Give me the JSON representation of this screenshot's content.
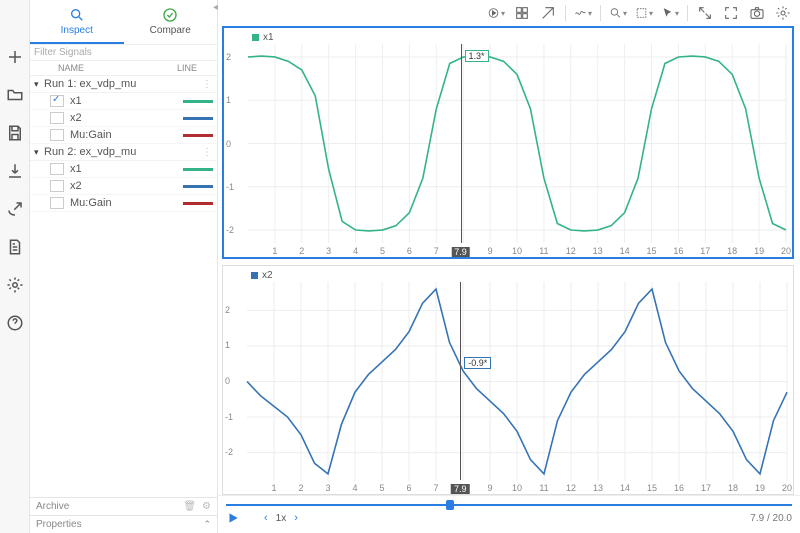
{
  "tabs": {
    "inspect": "Inspect",
    "compare": "Compare"
  },
  "filter_placeholder": "Filter Signals",
  "columns": {
    "name": "NAME",
    "line": "LINE"
  },
  "colors": {
    "green": "#34b38a",
    "blue": "#3573b3",
    "red": "#b22e2e",
    "accent": "#2a7de1"
  },
  "runs": [
    {
      "label": "Run 1: ex_vdp_mu",
      "signals": [
        {
          "label": "x1",
          "color_key": "green",
          "checked": true
        },
        {
          "label": "x2",
          "color_key": "blue",
          "checked": false
        },
        {
          "label": "Mu:Gain",
          "color_key": "red",
          "checked": false
        }
      ]
    },
    {
      "label": "Run 2: ex_vdp_mu",
      "signals": [
        {
          "label": "x1",
          "color_key": "green",
          "checked": false
        },
        {
          "label": "x2",
          "color_key": "blue",
          "checked": false
        },
        {
          "label": "Mu:Gain",
          "color_key": "red",
          "checked": false
        }
      ]
    }
  ],
  "panels": {
    "archive": "Archive",
    "properties": "Properties"
  },
  "cursor_time": 7.9,
  "playback": {
    "speed_label": "1x",
    "time_label": "7.9 / 20.0",
    "progress_frac": 0.395
  },
  "chart_data": [
    {
      "type": "line",
      "legend": "x1",
      "color_key": "green",
      "xlim": [
        0,
        20
      ],
      "ylim": [
        -2.3,
        2.3
      ],
      "yticks": [
        -2,
        -1,
        0,
        1,
        2
      ],
      "xticks": [
        1,
        2,
        3,
        4,
        5,
        6,
        7,
        8,
        9,
        10,
        11,
        12,
        13,
        14,
        15,
        16,
        17,
        18,
        19,
        20
      ],
      "cursor_tip": "1.3*",
      "x": [
        0,
        0.5,
        1,
        1.5,
        2,
        2.5,
        3,
        3.5,
        4,
        4.5,
        5,
        5.5,
        6,
        6.5,
        7,
        7.5,
        8,
        8.5,
        9,
        9.5,
        10,
        10.5,
        11,
        11.5,
        12,
        12.5,
        13,
        13.5,
        14,
        14.5,
        15,
        15.5,
        16,
        16.5,
        17,
        17.5,
        18,
        18.5,
        19,
        19.5,
        20
      ],
      "y": [
        2.0,
        2.02,
        2.0,
        1.9,
        1.7,
        1.1,
        -0.6,
        -1.8,
        -2.0,
        -2.02,
        -2.0,
        -1.9,
        -1.6,
        -0.8,
        0.8,
        1.85,
        2.0,
        2.02,
        2.0,
        1.9,
        1.6,
        0.8,
        -0.8,
        -1.85,
        -2.0,
        -2.02,
        -2.0,
        -1.9,
        -1.6,
        -0.8,
        0.8,
        1.85,
        2.0,
        2.02,
        2.0,
        1.9,
        1.6,
        0.8,
        -0.8,
        -1.85,
        -2.0
      ]
    },
    {
      "type": "line",
      "legend": "x2",
      "color_key": "blue",
      "xlim": [
        0,
        20
      ],
      "ylim": [
        -2.8,
        2.8
      ],
      "yticks": [
        -2,
        -1,
        0,
        1,
        2
      ],
      "xticks": [
        1,
        2,
        3,
        4,
        5,
        6,
        7,
        8,
        9,
        10,
        11,
        12,
        13,
        14,
        15,
        16,
        17,
        18,
        19,
        20
      ],
      "cursor_tip": "-0.9*",
      "x": [
        0,
        0.5,
        1,
        1.5,
        2,
        2.5,
        3,
        3.5,
        4,
        4.5,
        5,
        5.5,
        6,
        6.5,
        7,
        7.5,
        8,
        8.5,
        9,
        9.5,
        10,
        10.5,
        11,
        11.5,
        12,
        12.5,
        13,
        13.5,
        14,
        14.5,
        15,
        15.5,
        16,
        16.5,
        17,
        17.5,
        18,
        18.5,
        19,
        19.5,
        20
      ],
      "y": [
        0.0,
        -0.4,
        -0.7,
        -1.0,
        -1.5,
        -2.3,
        -2.6,
        -1.2,
        -0.3,
        0.2,
        0.55,
        0.9,
        1.4,
        2.2,
        2.6,
        1.1,
        0.3,
        -0.2,
        -0.55,
        -0.9,
        -1.4,
        -2.2,
        -2.6,
        -1.1,
        -0.3,
        0.2,
        0.55,
        0.9,
        1.4,
        2.2,
        2.6,
        1.1,
        0.3,
        -0.2,
        -0.55,
        -0.9,
        -1.4,
        -2.2,
        -2.6,
        -1.1,
        -0.3
      ]
    }
  ]
}
